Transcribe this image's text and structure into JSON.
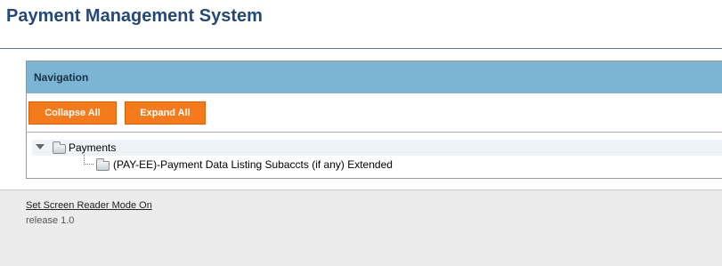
{
  "header": {
    "title": "Payment Management System"
  },
  "navigation": {
    "title": "Navigation",
    "collapse_label": "Collapse All",
    "expand_label": "Expand All",
    "tree": {
      "root_label": "Payments",
      "root_state": "expanded",
      "children": [
        {
          "label": "(PAY-EE)-Payment Data Listing Subaccts (if any) Extended"
        }
      ]
    }
  },
  "footer": {
    "screen_reader_link": "Set Screen Reader Mode On",
    "release": "release 1.0"
  },
  "colors": {
    "title": "#23497a",
    "nav_header": "#7ab6d4",
    "button": "#f47a1c",
    "background": "#ececec"
  },
  "icons": {
    "tree_toggle": "chevron-down-icon",
    "folder": "folder-icon"
  }
}
